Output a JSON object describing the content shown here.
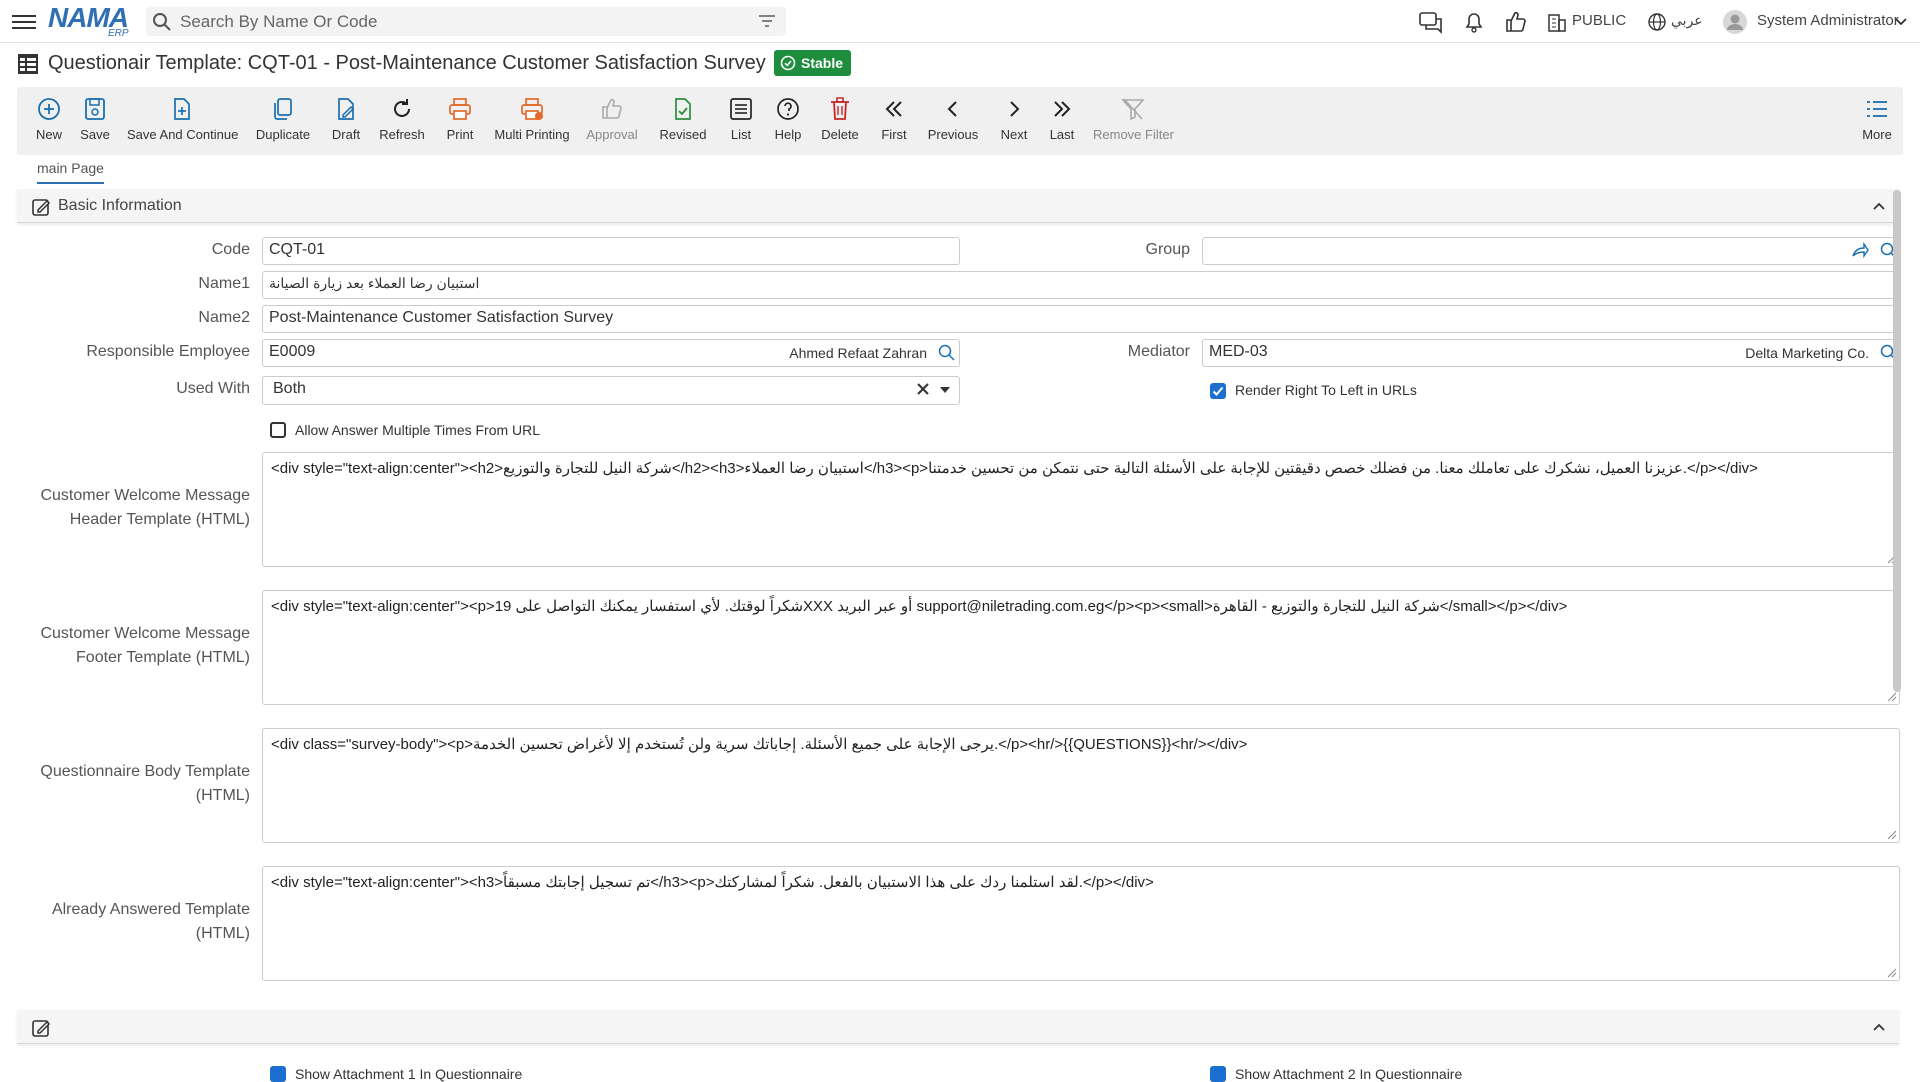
{
  "topbar": {
    "search_placeholder": "Search By Name Or Code",
    "logo_text": "NAMA",
    "logo_sub": "ERP",
    "public_label": "PUBLIC",
    "language_label": "عربي",
    "user_name": "System Administrator"
  },
  "page": {
    "title": "Questionair Template: CQT-01 - Post-Maintenance Customer Satisfaction Survey",
    "status_badge": "Stable"
  },
  "toolbar": {
    "new": "New",
    "save": "Save",
    "save_continue": "Save And Continue",
    "duplicate": "Duplicate",
    "draft": "Draft",
    "refresh": "Refresh",
    "print": "Print",
    "multi_printing": "Multi Printing",
    "approval": "Approval",
    "revised": "Revised",
    "list": "List",
    "help": "Help",
    "delete": "Delete",
    "first": "First",
    "previous": "Previous",
    "next": "Next",
    "last": "Last",
    "remove_filter": "Remove Filter",
    "more": "More"
  },
  "tabs": {
    "main": "main Page"
  },
  "section": {
    "basic_info": "Basic Information"
  },
  "form": {
    "code_label": "Code",
    "code_value": "CQT-01",
    "group_label": "Group",
    "group_value": "",
    "name1_label": "Name1",
    "name1_value": "استبيان رضا العملاء بعد زيارة الصيانة",
    "name2_label": "Name2",
    "name2_value": "Post-Maintenance Customer Satisfaction Survey",
    "responsible_label": "Responsible Employee",
    "responsible_code": "E0009",
    "responsible_name": "Ahmed Refaat Zahran",
    "mediator_label": "Mediator",
    "mediator_code": "MED-03",
    "mediator_name": "Delta Marketing Co.",
    "used_with_label": "Used With",
    "used_with_value": "Both",
    "rtl_label": "Render Right To Left in URLs",
    "allow_multi_label": "Allow Answer Multiple Times From URL",
    "header_tpl_label_1": "Customer Welcome Message",
    "header_tpl_label_2": "Header Template (HTML)",
    "header_tpl_value": "<div style=\"text-align:center\"><h2>شركة النيل للتجارة والتوزيع</h2><h3>استبيان رضا العملاء</h3><p>عزيزنا العميل، نشكرك على تعاملك معنا. من فضلك خصص دقيقتين للإجابة على الأسئلة التالية حتى نتمكن من تحسين خدمتنا.</p></div>",
    "footer_tpl_label_1": "Customer Welcome Message",
    "footer_tpl_label_2": "Footer Template (HTML)",
    "footer_tpl_value": "<div style=\"text-align:center\"><p>شكراً لوقتك. لأي استفسار يمكنك التواصل على 19XXX أو عبر البريد support@niletrading.com.eg</p><p><small>شركة النيل للتجارة والتوزيع - القاهرة</small></p></div>",
    "body_tpl_label_1": "Questionnaire Body Template",
    "body_tpl_label_2": "(HTML)",
    "body_tpl_value": "<div class=\"survey-body\"><p>يرجى الإجابة على جميع الأسئلة. إجاباتك سرية ولن تُستخدم إلا لأغراض تحسين الخدمة.</p><hr/>{{QUESTIONS}}<hr/></div>",
    "answered_tpl_label_1": "Already Answered Template",
    "answered_tpl_label_2": "(HTML)",
    "answered_tpl_value": "<div style=\"text-align:center\"><h3>تم تسجيل إجابتك مسبقاً</h3><p>لقد استلمنا ردك على هذا الاستبيان بالفعل. شكراً لمشاركتك.</p></div>",
    "attach1_label": "Show Attachment 1 In Questionnaire",
    "attach2_label": "Show Attachment 2 In Questionnaire"
  }
}
